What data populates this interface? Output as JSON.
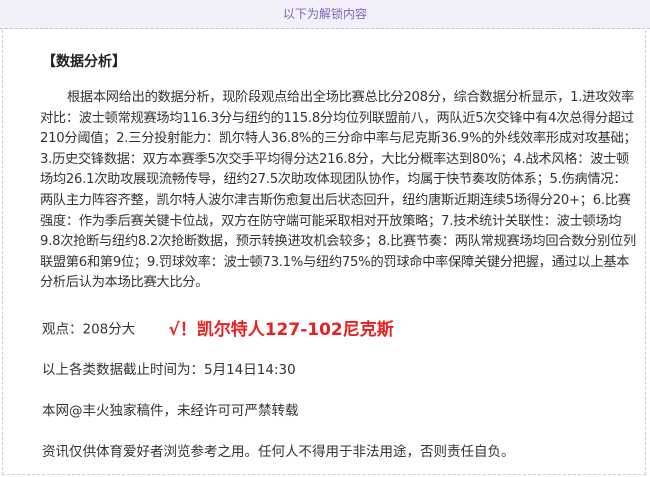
{
  "unlock_banner": "以下为解锁内容",
  "section_heading": "【数据分析】",
  "analysis_paragraph": "根据本网给出的数据分析，现阶段观点给出全场比赛总比分208分，综合数据分析显示，1.进攻效率对比：波士顿常规赛场均116.3分与纽约的115.8分均位列联盟前八，两队近5次交锋中有4次总得分超过210分阈值；2.三分投射能力：凯尔特人36.8%的三分命中率与尼克斯36.9%的外线效率形成对攻基础；3.历史交锋数据：双方本赛季5次交手平均得分达216.8分，大比分概率达到80%；4.战术风格：波士顿场均26.1次助攻展现流畅传导，纽约27.5次助攻体现团队协作，均属于快节奏攻防体系；5.伤病情况：两队主力阵容齐整，凯尔特人波尔津吉斯伤愈复出后状态回升，纽约唐斯近期连续5场得分20+；6.比赛强度：作为季后赛关键卡位战，双方在防守端可能采取相对开放策略；7.技术统计关联性：波士顿场均9.8次抢断与纽约8.2次抢断数据，预示转换进攻机会较多；8.比赛节奏：两队常规赛场均回合数分别位列联盟第6和第9位；9.罚球效率：波士顿73.1%与纽约75%的罚球命中率保障关键分把握，通过以上基本分析后认为本场比赛大比分。",
  "view_label": "观点：208分大",
  "view_result": "√！凯尔特人127-102尼克斯",
  "data_cutoff": "以上各类数据截止时间为：5月14日14:30",
  "copyright_note": "本网@丰火独家稿件，未经许可可严禁转载",
  "disclaimer": "资讯仅供体育爱好者浏览参考之用。任何人不得用于非法用途，否则责任自负。",
  "colors": {
    "accent_red": "#e8201f",
    "banner_bg": "#f3f0fa",
    "banner_text": "#7a68b8"
  }
}
